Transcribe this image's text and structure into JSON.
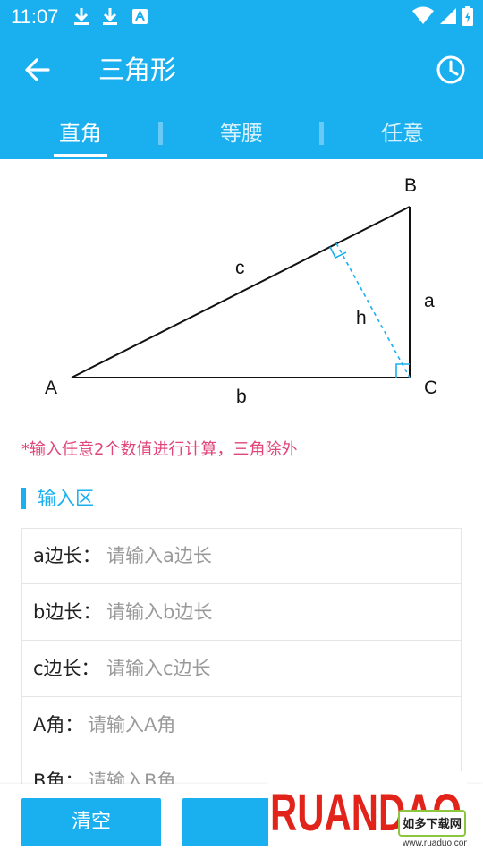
{
  "status_bar": {
    "time": "11:07",
    "icons": [
      "download-icon",
      "download-icon",
      "app-notification-icon",
      "wifi-icon",
      "signal-icon",
      "battery-icon"
    ]
  },
  "app_bar": {
    "title": "三角形",
    "back_icon": "arrow-left-icon",
    "history_icon": "clock-icon"
  },
  "tabs": [
    {
      "label": "直角",
      "active": true
    },
    {
      "label": "等腰",
      "active": false
    },
    {
      "label": "任意",
      "active": false
    }
  ],
  "diagram": {
    "vertices": {
      "A": "A",
      "B": "B",
      "C": "C"
    },
    "sides": {
      "a": "a",
      "b": "b",
      "c": "c",
      "h": "h"
    }
  },
  "hint": "*输入任意2个数值进行计算，三角除外",
  "section_title": "输入区",
  "inputs": [
    {
      "label": "a边长：",
      "placeholder": "请输入a边长",
      "value": ""
    },
    {
      "label": "b边长：",
      "placeholder": "请输入b边长",
      "value": ""
    },
    {
      "label": "c边长：",
      "placeholder": "请输入c边长",
      "value": ""
    },
    {
      "label": "A角：",
      "placeholder": "请输入A角",
      "value": ""
    },
    {
      "label": "B角：",
      "placeholder": "请输入B角",
      "value": ""
    }
  ],
  "buttons": {
    "clear": "清空",
    "calculate": ""
  },
  "watermark": {
    "brand": "RUANDAO",
    "sub": "如多下载网",
    "url": "www.ruaduo.com"
  },
  "colors": {
    "primary": "#1ab0f0",
    "hint": "#e0457b",
    "watermark_red": "#e2231a",
    "watermark_orange": "#f39800",
    "watermark_green": "#8cc63f"
  }
}
